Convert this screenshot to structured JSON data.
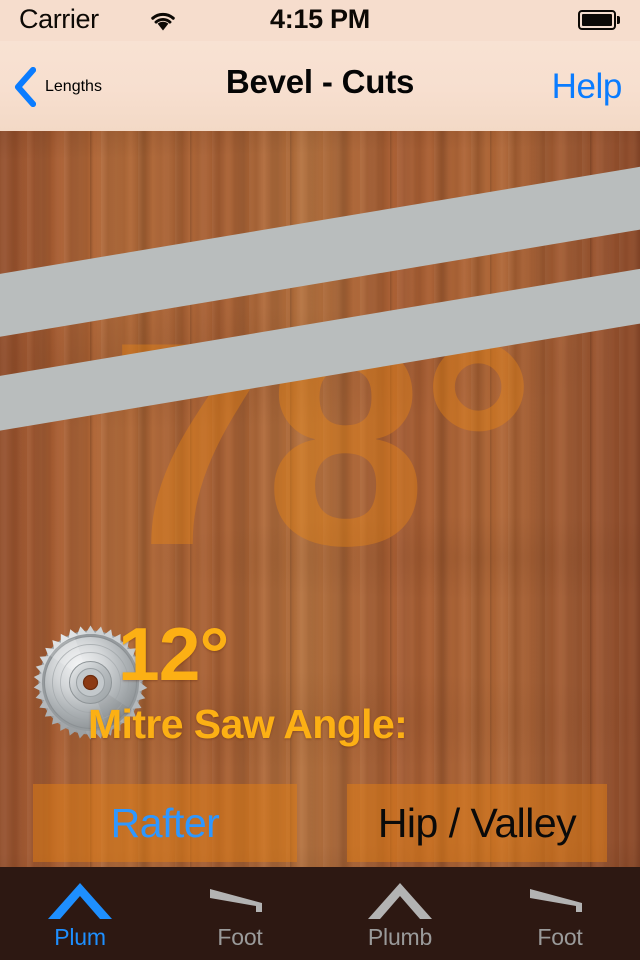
{
  "status_bar": {
    "carrier": "Carrier",
    "wifi_icon": "wifi-icon",
    "time": "4:15 PM",
    "battery_icon": "battery-full-icon"
  },
  "nav_bar": {
    "back_icon": "chevron-left-icon",
    "back_label": "Lengths",
    "title": "Bevel - Cuts",
    "help_label": "Help"
  },
  "main": {
    "watermark_angle": "78°",
    "saw_blade_icon": "circular-saw-blade-icon",
    "angle_value": "12°",
    "angle_label": "Mitre Saw Angle:",
    "buttons": [
      {
        "label": "Rafter",
        "name": "rafter-button"
      },
      {
        "label": "Hip / Valley",
        "name": "hip-valley-button"
      }
    ]
  },
  "tab_bar": {
    "tabs": [
      {
        "label": "Plum",
        "icon": "roof-peak-icon",
        "active": true
      },
      {
        "label": "Foot",
        "icon": "birdsmouth-icon",
        "active": false
      },
      {
        "label": "Plumb",
        "icon": "roof-peak-icon",
        "active": false
      },
      {
        "label": "Foot",
        "icon": "birdsmouth-icon",
        "active": false
      }
    ]
  },
  "colors": {
    "accent_blue": "#0a7cff",
    "tab_active_blue": "#1e8fff",
    "angle_amber": "#fcb014",
    "wood_brown": "#a85c31",
    "tab_bar_dark": "#2d1812",
    "cut_band_gray": "#b9bdbd",
    "status_bar_peach": "#f6ddcd"
  }
}
